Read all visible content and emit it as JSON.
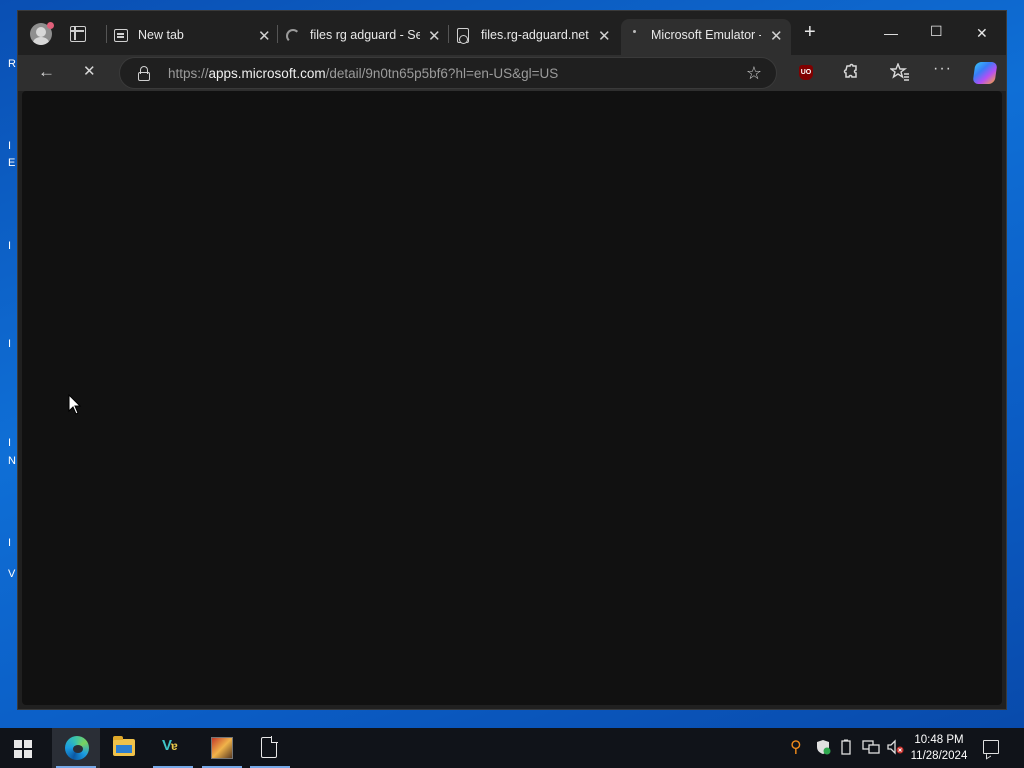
{
  "desktop": {
    "edge_letters": [
      "R",
      "I",
      "E",
      "I",
      "I",
      "I",
      "I",
      "N",
      "I",
      "I",
      "V"
    ]
  },
  "browser": {
    "tabs": [
      {
        "title": "New tab",
        "icon": "new-tab-icon",
        "close": "✕"
      },
      {
        "title": "files rg adguard - Se",
        "icon": "loading-spinner-icon",
        "close": "✕"
      },
      {
        "title": "files.rg-adguard.net",
        "icon": "page-icon",
        "close": "✕"
      },
      {
        "title": "Microsoft Emulator -",
        "icon": "loading-dot-icon",
        "close": "✕",
        "active": true
      }
    ],
    "new_tab_button": "+",
    "window_controls": {
      "minimize": "—",
      "maximize": "☐",
      "close": "✕"
    },
    "toolbar": {
      "back": "←",
      "stop": "✕",
      "url_prefix": "https://",
      "url_host": "apps.microsoft.com",
      "url_path": "/detail/9n0tn65p5bf6?hl=en-US&gl=US",
      "favorite_icon": "☆",
      "ublock_label": "UO",
      "extensions_icon": "puzzle-icon",
      "favorites_icon": "favorites-icon",
      "more_icon": "···"
    },
    "page_loading": true
  },
  "taskbar": {
    "apps": [
      "edge",
      "file-explorer",
      "visual-studio",
      "game",
      "file"
    ],
    "clock_time": "10:48 PM",
    "clock_date": "11/28/2024"
  },
  "colors": {
    "desktop": "#0f6fd6",
    "browser_chrome": "#202020",
    "toolbar": "#2f2f2f",
    "viewport": "#111111",
    "taskbar": "#101319"
  }
}
